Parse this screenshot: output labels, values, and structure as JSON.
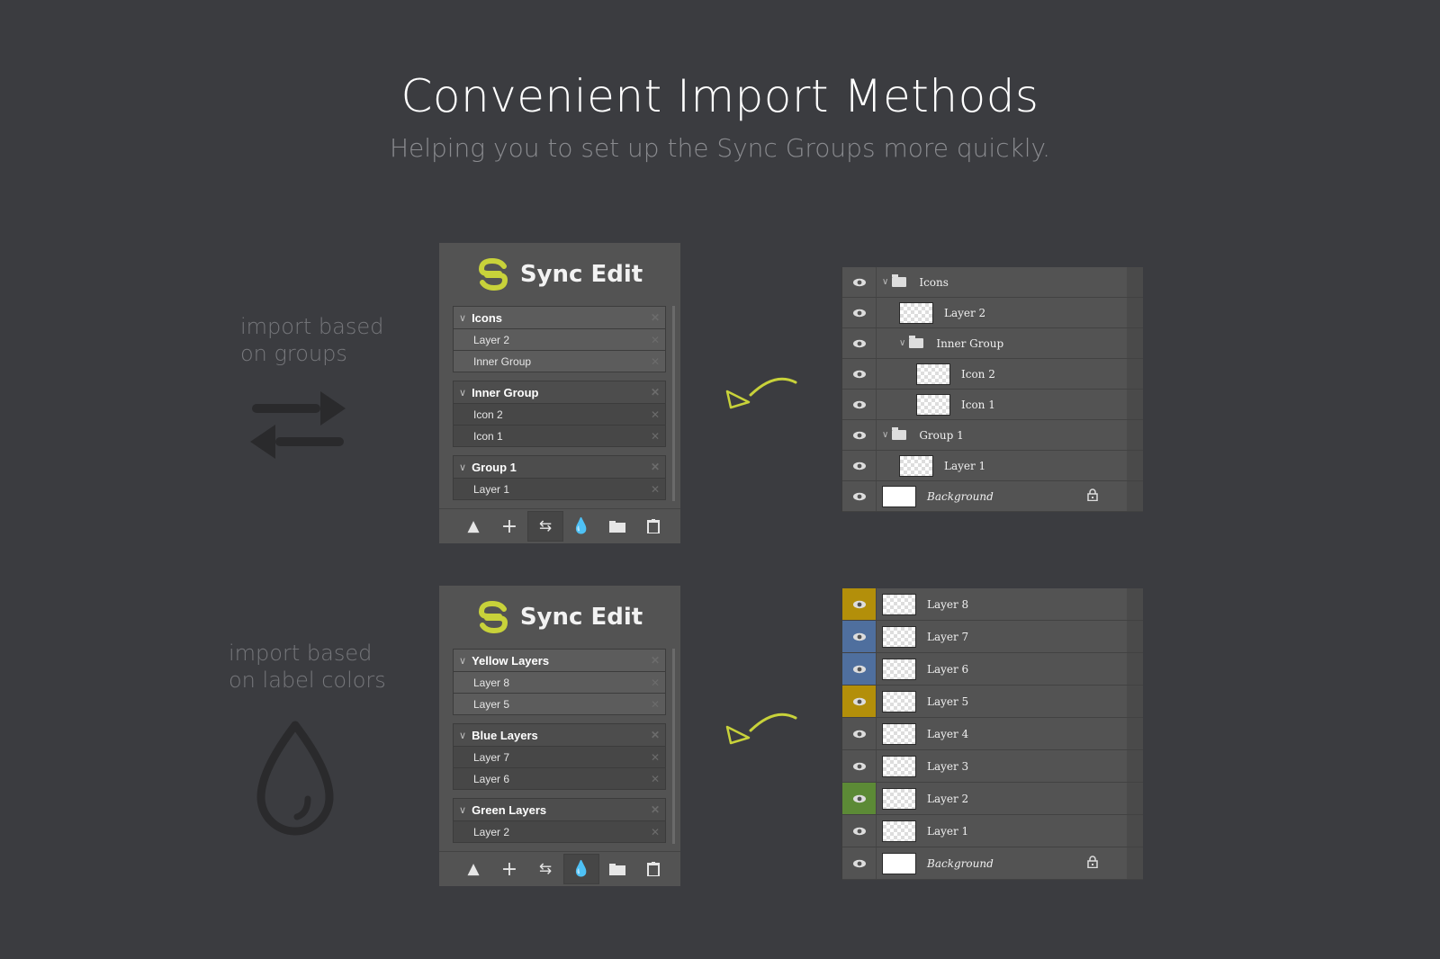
{
  "header": {
    "title": "Convenient Import Methods",
    "subtitle": "Helping you to set up the Sync Groups more quickly."
  },
  "colors": {
    "background": "#3b3c40",
    "accent_yellow": "#c8cc3a",
    "label_yellow": "#b38f0a",
    "label_blue": "#4f6f9e",
    "label_green": "#5c8a36"
  },
  "sections": [
    {
      "caption_line1": "import based",
      "caption_line2": "on groups",
      "icon": "swap-arrows-icon",
      "panel": {
        "title": "Sync Edit",
        "logo": "sync-edit-logo-icon",
        "groups": [
          {
            "name": "Icons",
            "items": [
              "Layer 2",
              "Inner Group"
            ]
          },
          {
            "name": "Inner Group",
            "items": [
              "Icon 2",
              "Icon 1"
            ]
          },
          {
            "name": "Group 1",
            "items": [
              "Layer 1"
            ]
          }
        ],
        "toolbar": [
          "move-up-icon",
          "add-icon",
          "import-groups-icon",
          "import-colors-icon",
          "folder-icon",
          "trash-icon"
        ],
        "active_tool": "import-groups-icon"
      },
      "layers": [
        {
          "name": "Icons",
          "type": "group",
          "indent": 0
        },
        {
          "name": "Layer 2",
          "type": "layer",
          "indent": 1
        },
        {
          "name": "Inner Group",
          "type": "group",
          "indent": 1
        },
        {
          "name": "Icon 2",
          "type": "layer",
          "indent": 2
        },
        {
          "name": "Icon 1",
          "type": "layer",
          "indent": 2
        },
        {
          "name": "Group 1",
          "type": "group",
          "indent": 0
        },
        {
          "name": "Layer 1",
          "type": "layer",
          "indent": 1
        },
        {
          "name": "Background",
          "type": "background",
          "indent": 0,
          "locked": true
        }
      ]
    },
    {
      "caption_line1": "import based",
      "caption_line2": "on label colors",
      "icon": "drop-icon",
      "panel": {
        "title": "Sync Edit",
        "logo": "sync-edit-logo-icon",
        "groups": [
          {
            "name": "Yellow Layers",
            "items": [
              "Layer 8",
              "Layer 5"
            ]
          },
          {
            "name": "Blue Layers",
            "items": [
              "Layer 7",
              "Layer 6"
            ]
          },
          {
            "name": "Green Layers",
            "items": [
              "Layer 2"
            ]
          }
        ],
        "toolbar": [
          "move-up-icon",
          "add-icon",
          "import-groups-icon",
          "import-colors-icon",
          "folder-icon",
          "trash-icon"
        ],
        "active_tool": "import-colors-icon"
      },
      "layers": [
        {
          "name": "Layer 8",
          "type": "layer",
          "label": "yellow"
        },
        {
          "name": "Layer 7",
          "type": "layer",
          "label": "blue"
        },
        {
          "name": "Layer 6",
          "type": "layer",
          "label": "blue"
        },
        {
          "name": "Layer 5",
          "type": "layer",
          "label": "yellow"
        },
        {
          "name": "Layer 4",
          "type": "layer",
          "label": "none"
        },
        {
          "name": "Layer 3",
          "type": "layer",
          "label": "none"
        },
        {
          "name": "Layer 2",
          "type": "layer",
          "label": "green"
        },
        {
          "name": "Layer 1",
          "type": "layer",
          "label": "none"
        },
        {
          "name": "Background",
          "type": "background",
          "label": "none",
          "locked": true
        }
      ]
    }
  ]
}
